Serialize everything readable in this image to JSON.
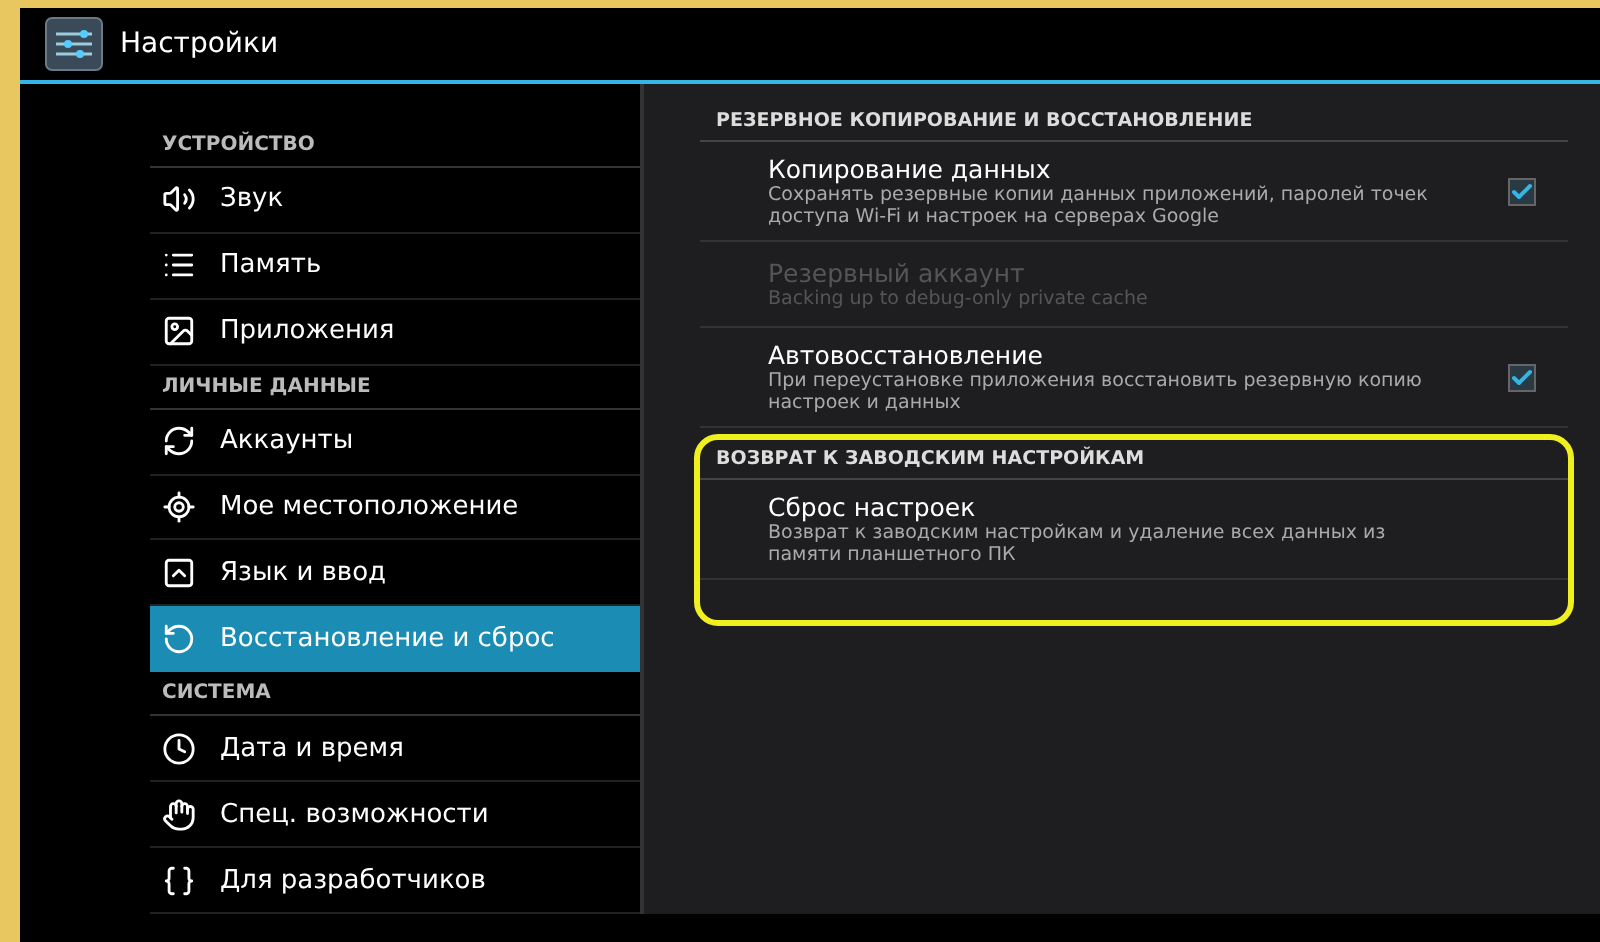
{
  "window": {
    "title": "Настройки"
  },
  "sidebar": {
    "groups": [
      {
        "header": "УСТРОЙСТВО",
        "items": [
          {
            "label": "Звук",
            "selected": false
          },
          {
            "label": "Память",
            "selected": false
          },
          {
            "label": "Приложения",
            "selected": false
          }
        ]
      },
      {
        "header": "ЛИЧНЫЕ ДАННЫЕ",
        "items": [
          {
            "label": "Аккаунты",
            "selected": false
          },
          {
            "label": "Мое местоположение",
            "selected": false
          },
          {
            "label": "Язык и ввод",
            "selected": false
          },
          {
            "label": "Восстановление и сброс",
            "selected": true
          }
        ]
      },
      {
        "header": "СИСТЕМА",
        "items": [
          {
            "label": "Дата и время",
            "selected": false
          },
          {
            "label": "Спец. возможности",
            "selected": false
          },
          {
            "label": "Для разработчиков",
            "selected": false
          }
        ]
      }
    ]
  },
  "sections": [
    {
      "header": "РЕЗЕРВНОЕ КОПИРОВАНИЕ И ВОССТАНОВЛЕНИЕ",
      "highlighted": false,
      "items": [
        {
          "title": "Копирование данных",
          "summary": "Сохранять резервные копии данных приложений, паролей точек доступа Wi-Fi и настроек на серверах Google",
          "kind": "checkbox",
          "checked": true,
          "disabled": false
        },
        {
          "title": "Резервный аккаунт",
          "summary": "Backing up to debug-only private cache",
          "kind": "plain",
          "disabled": true
        },
        {
          "title": "Автовосстановление",
          "summary": "При переустановке приложения восстановить резервную копию настроек и данных",
          "kind": "checkbox",
          "checked": true,
          "disabled": false
        }
      ]
    },
    {
      "header": "ВОЗВРАТ К ЗАВОДСКИМ НАСТРОЙКАМ",
      "highlighted": true,
      "items": [
        {
          "title": "Сброс настроек",
          "summary": "Возврат к заводским настройкам и удаление всех данных из памяти планшетного ПК",
          "kind": "plain",
          "disabled": false
        }
      ]
    }
  ]
}
